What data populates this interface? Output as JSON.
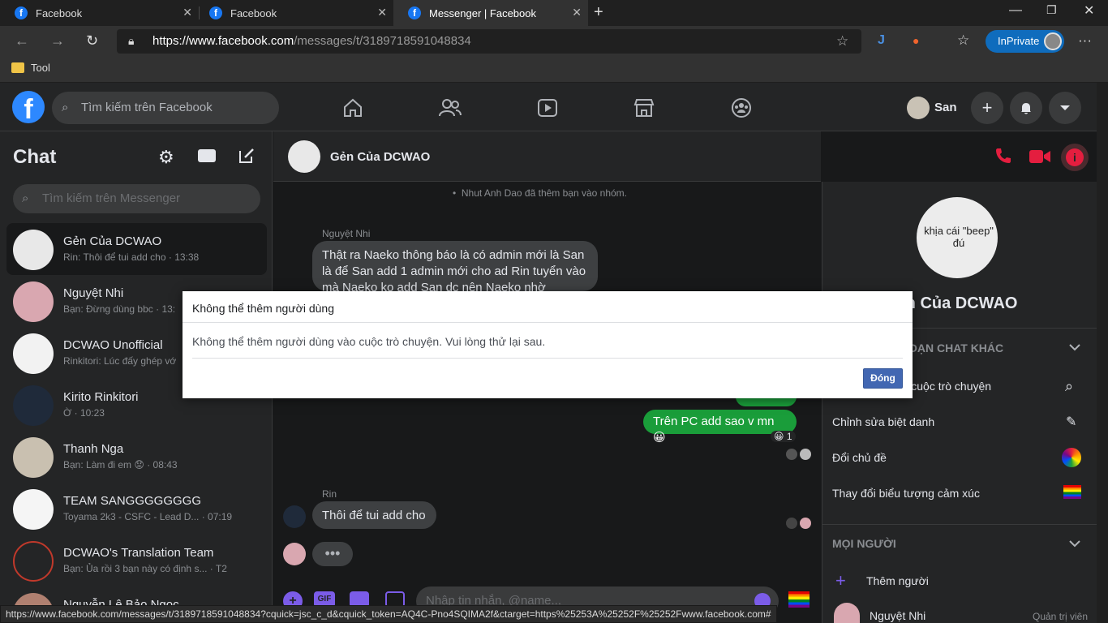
{
  "browser": {
    "tabs": [
      {
        "label": "Facebook"
      },
      {
        "label": "Facebook"
      },
      {
        "label": "Messenger | Facebook"
      }
    ],
    "url_domain": "https://www.facebook.com",
    "url_path": "/messages/t/3189718591048834",
    "bookmark": "Tool",
    "inprivate_label": "InPrivate",
    "status_url": "https://www.facebook.com/messages/t/3189718591048834?cquick=jsc_c_d&cquick_token=AQ4C-Pno4SQIMA2f&ctarget=https%25253A%25252F%25252Fwww.facebook.com#"
  },
  "header": {
    "search_placeholder": "Tìm kiếm trên Facebook",
    "user_name": "San"
  },
  "sidebar": {
    "title": "Chat",
    "search_placeholder": "Tìm kiếm trên Messenger",
    "conversations": [
      {
        "name": "Gẻn Của DCWAO",
        "snippet": "Rin: Thôi để tui add cho · 13:38"
      },
      {
        "name": "Nguyệt Nhi",
        "snippet": "Bạn: Đừng dùng bbc · 13:"
      },
      {
        "name": "DCWAO Unofficial",
        "snippet": "Rinkitori: Lúc đấy ghép vớ"
      },
      {
        "name": "Kirito Rinkitori",
        "snippet": "Ờ · 10:23"
      },
      {
        "name": "Thanh Nga",
        "snippet": "Bạn: Làm đi em 😟 · 08:43"
      },
      {
        "name": "TEAM SANGGGGGGGG",
        "snippet": "Toyama 2k3 - CSFC - Lead D... · 07:19"
      },
      {
        "name": "DCWAO's Translation Team",
        "snippet": "Bạn: Ủa rồi 3 bạn này có định s... · T2"
      },
      {
        "name": "Nguyễn Lê Bảo Ngọc",
        "snippet": ""
      }
    ]
  },
  "chat": {
    "title": "Gẻn Của DCWAO",
    "system_note": "Nhut Anh Dao đã thêm bạn vào nhóm.",
    "sender1": "Nguyệt Nhi",
    "msg1": "Thật ra Naeko thông báo là có admin mới là San là để San add 1 admin mới cho ad Rin tuyển vào mà Naeko ko add San dc nên Naeko nhờ Econan",
    "msg_own": "Trên PC add sao v mn 😀",
    "reaction": "😀 1",
    "sender2": "Rin",
    "msg2": "Thôi để tui add cho",
    "typing": "•••",
    "composer_placeholder": "Nhập tin nhắn, @name..."
  },
  "right_panel": {
    "group_name": "Gẻn Của DCWAO",
    "avatar_text": "khịa cái \"beep\" đú",
    "section_more": "TÙY CHỈNH ĐOẠN CHAT KHÁC",
    "items": [
      "Tìm kiếm trong cuộc trò chuyện",
      "Chỉnh sửa biệt danh",
      "Đổi chủ đề",
      "Thay đổi biểu tượng cảm xúc"
    ],
    "section_people": "MỌI NGƯỜI",
    "add_people": "Thêm người",
    "member_name": "Nguyệt Nhi",
    "member_role": "Quản trị viên"
  },
  "dialog": {
    "title": "Không thể thêm người dùng",
    "message": "Không thể thêm người dùng vào cuộc trò chuyện. Vui lòng thử lại sau.",
    "button": "Đóng"
  },
  "colors": {
    "fb_blue": "#1877f2",
    "own_bubble": "#1a9d3a",
    "call_red": "#e41e3f",
    "dialog_button": "#4267b2"
  }
}
